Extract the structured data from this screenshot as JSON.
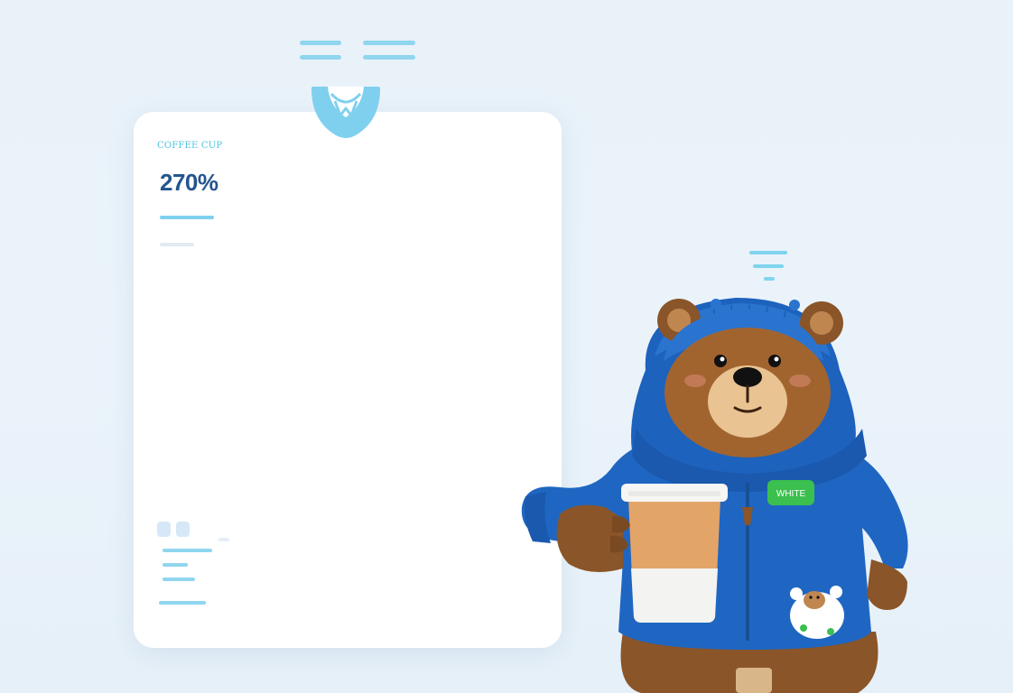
{
  "card": {
    "label": "COFFEE CUP",
    "value": "270%"
  },
  "bear": {
    "badge_text": "WHITE"
  },
  "colors": {
    "accent": "#4cc3df",
    "value_text": "#24558f",
    "hoodie": "#1f66c2",
    "badge": "#3bbf4f",
    "background": "#e9f2f9"
  },
  "icons": [
    "coffee-clip-icon",
    "coffee-cup-icon"
  ]
}
